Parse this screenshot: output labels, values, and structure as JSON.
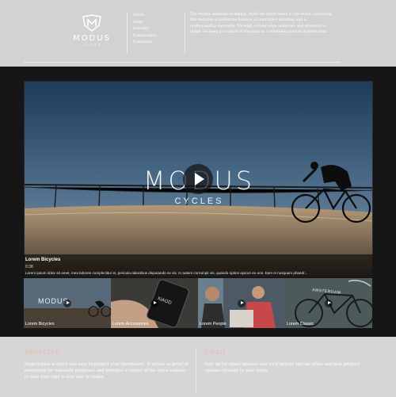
{
  "brand": {
    "name": "MODUS",
    "sub": "CYCLES"
  },
  "nav": [
    {
      "label": "Store"
    },
    {
      "label": "Gear"
    },
    {
      "label": "Retailer"
    },
    {
      "label": "Community"
    },
    {
      "label": "Company"
    }
  ],
  "tagline": "The Modus aesthetic is simple. Build the finest bikes in the world. Achieving this requires a deliberate balance of innovative detailing and a craftsmanship mentality. Through cutting edge materials and attention to detail, we keep you ahead of the pack in a relentless pursuit of perfection.",
  "video": {
    "title": "Lorem Bicycles",
    "time": "0:38",
    "description": "Lorem ipsum dolor sit amet, mea labores complectitur ei, pericula rationibus disputando ex vix. In autem corrumpit vis, quando option epicuri eu eos. Eam ei nusquam phaedr...",
    "overlay_brand": "MODUS",
    "overlay_sub": "CYCLES"
  },
  "thumbnails": [
    {
      "label": "Lorem Bicycles"
    },
    {
      "label": "Lorem Accessories"
    },
    {
      "label": "Lorem People"
    },
    {
      "label": "Lorem Classic"
    }
  ],
  "thumb_overlay": {
    "brand": "MODUS",
    "phone_text": "XIAOD",
    "frame_text": "AMSTERDAM"
  },
  "footer": {
    "register": {
      "title": "REGISTER",
      "text": "Registration is quick and easy to protect your investment. It serves as proof of ownership for warranty purposes, and provides a record of the serial number in case your bike is ever lost or stolen."
    },
    "email": {
      "title": "EMAIL",
      "text": "Sign up for email updates and we'll deliver special offers and new product updates straight to your inbox."
    }
  }
}
